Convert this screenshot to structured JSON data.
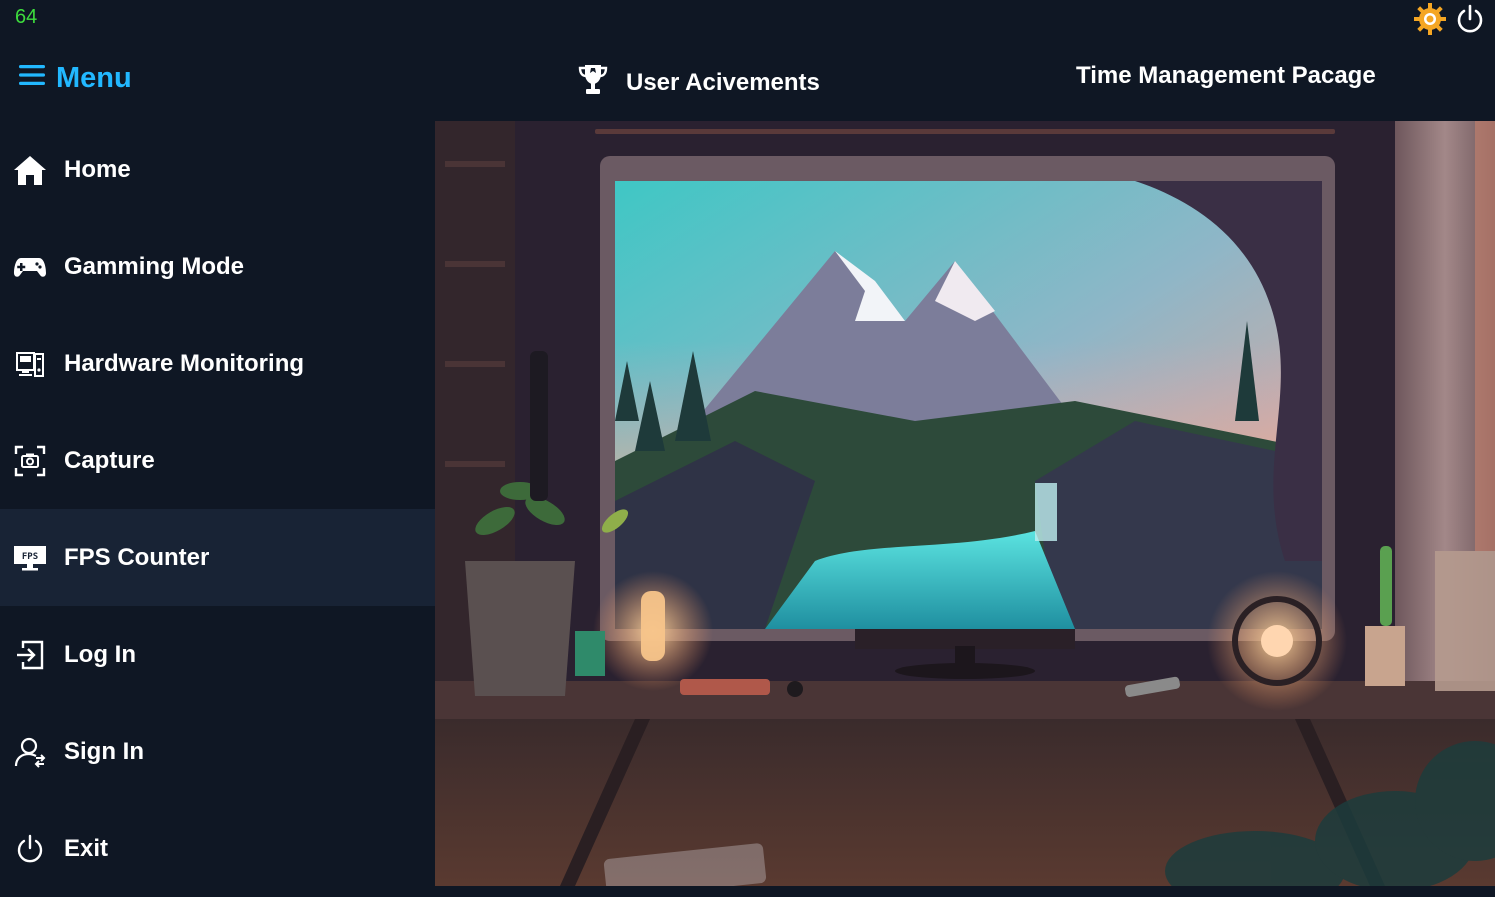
{
  "status": {
    "fps_value": "64"
  },
  "topbar": {
    "menu_label": "Menu",
    "achievements_label": "User Acivements",
    "time_mgmt_label": "Time Management Pacage",
    "icons": [
      "gear-icon",
      "power-icon"
    ]
  },
  "sidebar": {
    "items": [
      {
        "label": "Home",
        "icon": "home-icon",
        "active": false
      },
      {
        "label": "Gamming Mode",
        "icon": "gamepad-icon",
        "active": false
      },
      {
        "label": "Hardware Monitoring",
        "icon": "hardware-monitor-icon",
        "active": false
      },
      {
        "label": "Capture",
        "icon": "camera-capture-icon",
        "active": false
      },
      {
        "label": "FPS Counter",
        "icon": "fps-monitor-icon",
        "active": true
      },
      {
        "label": "Log In",
        "icon": "login-icon",
        "active": false
      },
      {
        "label": "Sign In",
        "icon": "user-icon",
        "active": false
      },
      {
        "label": "Exit",
        "icon": "power-icon",
        "active": false
      }
    ]
  },
  "colors": {
    "background": "#0f1724",
    "sidebar_active": "#182335",
    "accent_cyan": "#22b8ff",
    "fps_green": "#3ddc3d",
    "gear_orange": "#f5a623"
  }
}
